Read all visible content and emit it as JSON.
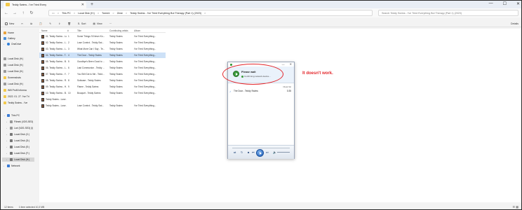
{
  "window": {
    "tab_title": "Teddy Swims - I've Tried Every",
    "tab_close": "✕",
    "new_tab": "+",
    "controls": [
      "—",
      "☐",
      "✕"
    ]
  },
  "addressbar": {
    "back": "←",
    "forward": "→",
    "up": "↑",
    "refresh": "↻",
    "breadcrumbs": [
      "This PC",
      "Local Disk (H:)",
      "Torrent",
      "Zene",
      "Teddy Swims - I've Tried Everything But Therapy (Part 1) (2023)"
    ],
    "separator": ">",
    "search_placeholder": "Search Teddy Swims - I've Tried Everything But Therapy (Part 1) (2023)"
  },
  "toolbar": {
    "new": "New",
    "sort": "Sort",
    "view": "View",
    "more": "···",
    "details": "Details"
  },
  "nav": {
    "quick": [
      "Home",
      "Gallery",
      "OneDrive"
    ],
    "pinned": [
      "Local Disk (H:)",
      "Local Disk (H:)",
      "Local Disk (H:)",
      "Screenshots",
      "Local Disk (H:)",
      "Wifi Profil Informa",
      "2022. 01. 27. I've Tri",
      "Teddy Swims - I've"
    ],
    "thispc": "This PC",
    "drives": [
      "Filmek (\\\\DS-SE3)",
      "Lari (\\\\DS-SE3) (I)",
      "Local Disk (C:)",
      "Local Disk (D:)",
      "Local Disk (E:)",
      "Local Disk (F:)",
      "Local Disk (H:)"
    ],
    "network": "Network"
  },
  "filelist": {
    "headers": [
      "Name",
      "#",
      "Title",
      "Contributing artists",
      "Album"
    ],
    "rows": [
      {
        "name": "01. Teddy Swims - Lo...",
        "num": "1",
        "title": "Some Things I'll Never Kn...",
        "artist": "Teddy Swims",
        "album": "I've Tried Everything..."
      },
      {
        "name": "02. Teddy Swims - L...",
        "num": "2",
        "title": "Lose Control - Teddy Swi...",
        "artist": "Teddy Swims",
        "album": "I've Tried Everything..."
      },
      {
        "name": "03. Teddy Swims - L...",
        "num": "3",
        "title": "What More Can I Say - Te...",
        "artist": "Teddy Swims",
        "album": "I've Tried Everything..."
      },
      {
        "name": "04. Teddy Swims - T...",
        "num": "4",
        "title": "The Door - Teddy Swims",
        "artist": "Teddy Swims",
        "album": "I've Tried Everything..."
      },
      {
        "name": "05. Teddy Swims - B...",
        "num": "5",
        "title": "Goodbye's Been Good to ...",
        "artist": "Teddy Swims",
        "album": "I've Tried Everything..."
      },
      {
        "name": "06. Teddy Swims - L...",
        "num": "6",
        "title": "Last Communion - Teddy ...",
        "artist": "Teddy Swims",
        "album": "I've Tried Everything..."
      },
      {
        "name": "07. Teddy Swims - Y...",
        "num": "7",
        "title": "You Still Got to Me - Tedd...",
        "artist": "Teddy Swims",
        "album": "I've Tried Everything..."
      },
      {
        "name": "08. Teddy Swims - R...",
        "num": "8",
        "title": "Suitcase - Teddy Swims",
        "artist": "Teddy Swims",
        "album": "I've Tried Everything..."
      },
      {
        "name": "09. Teddy Swims - H...",
        "num": "9",
        "title": "Flame - Teddy Swims",
        "artist": "Teddy Swims",
        "album": "I've Tried Everything..."
      },
      {
        "name": "10. Teddy Swims - B...",
        "num": "10",
        "title": "Bouquet - Teddy Swims",
        "artist": "Teddy Swims",
        "album": "I've Tried Everything..."
      },
      {
        "name": "Teddy Swims - Lose ...",
        "num": "",
        "title": "",
        "artist": "",
        "album": ""
      },
      {
        "name": "Teddy Swims - Lose ...",
        "num": "",
        "title": "Lose Control - Teddy Swi...",
        "artist": "Teddy Swims",
        "album": "I've Tried Everything..."
      }
    ],
    "selected_index": 3
  },
  "statusbar": {
    "items": "12 items",
    "selected": "1 item selected  10,3 MB"
  },
  "player": {
    "title": "Media Player",
    "wait_title": "Please wait",
    "wait_sub": "Confirming network device...",
    "clear_list": "Clear list",
    "track_name": "The Door - Teddy Swims",
    "track_length": "3:35",
    "controls": {
      "shuffle": "⇄",
      "prev": "⏮",
      "next": "⏭",
      "repeat": "↻",
      "stop": "■"
    }
  },
  "annotation": {
    "text": "It doesn't work.",
    "color": "#e3262b"
  }
}
